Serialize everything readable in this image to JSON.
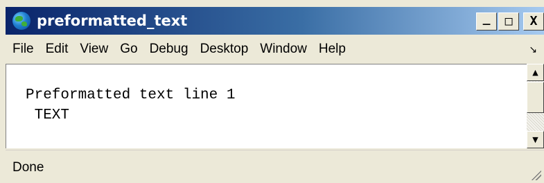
{
  "window": {
    "title": "preformatted_text",
    "controls": {
      "minimize": "_",
      "maximize": "□",
      "close": "X"
    }
  },
  "menu": {
    "items": [
      "File",
      "Edit",
      "View",
      "Go",
      "Debug",
      "Desktop",
      "Window",
      "Help"
    ]
  },
  "content": {
    "lines": [
      "Preformatted text line 1",
      " TEXT"
    ]
  },
  "status": {
    "text": "Done"
  },
  "icons": {
    "app": "globe-icon",
    "menu_overflow": "chevron-icon",
    "scroll_up": "arrow-up-icon",
    "scroll_down": "arrow-down-icon",
    "resize": "resize-grip-icon"
  },
  "colors": {
    "title_start": "#0a246a",
    "title_end": "#a6caf0",
    "chrome": "#ece9d8",
    "content_bg": "#ffffff"
  }
}
